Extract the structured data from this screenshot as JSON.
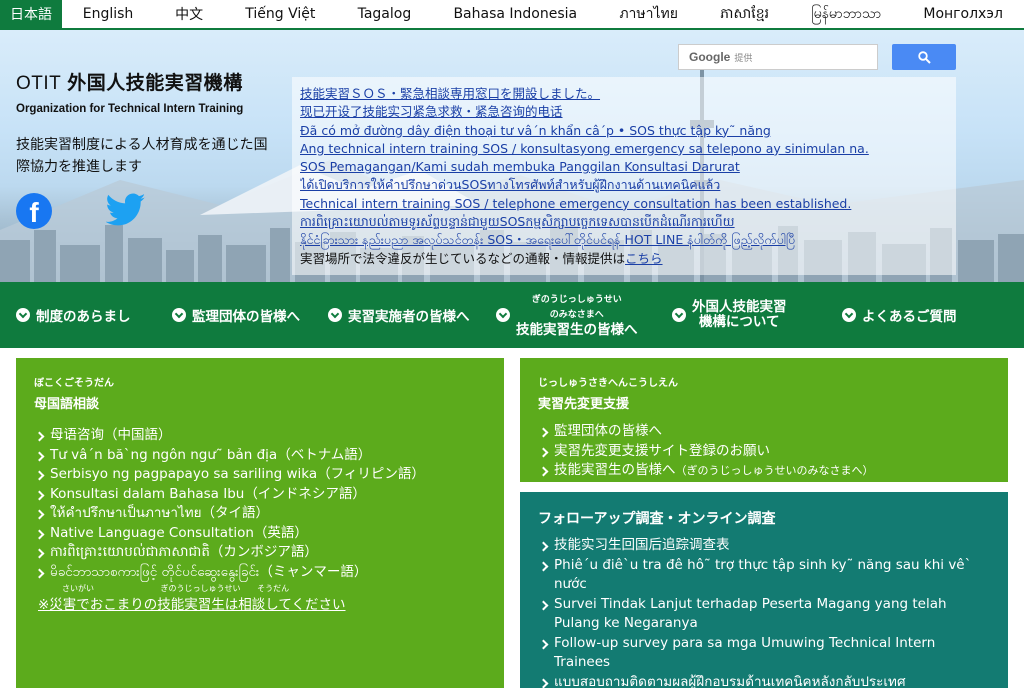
{
  "languages": [
    "日本語",
    "English",
    "中文",
    "Tiếng Việt",
    "Tagalog",
    "Bahasa Indonesia",
    "ภาษาไทย",
    "ភាសាខ្មែរ",
    "မြန်မာဘာသာ",
    "Монголхэл"
  ],
  "brand": {
    "abbr": "OTIT",
    "name_jp": "外国人技能実習機構",
    "name_en": "Organization for Technical Intern Training",
    "tagline": "技能実習制度による人材育成を通じた国際協力を推進します"
  },
  "search": {
    "logo": "Google",
    "provider": "提供"
  },
  "icons": {
    "facebook": "facebook-icon",
    "twitter": "twitter-icon",
    "search": "search-icon",
    "chevron": "chevron-down-icon"
  },
  "notices": [
    "技能実習ＳＯＳ・緊急相談専用窓口を開設しました。",
    "现已开设了技能实习紧急求救・紧急咨询的电话",
    "Đã có mở đường dây điện thoại tư vâ´n khẩn câ´p • SOS thực tập ky˜ năng",
    "Ang technical intern training SOS / konsultasyong emergency sa telepono ay sinimulan na.",
    "SOS Pemagangan/Kami sudah membuka Panggilan Konsultasi Darurat",
    "ได้เปิดบริการให้คำปรึกษาด่วนSOSทางโทรศัพท์สำหรับผู้ฝึกงานด้านเทคนิคแล้ว",
    "Technical intern training SOS / telephone emergency consultation has been established.",
    "ការពិគ្រោះយោបល់តាមទូរស័ព្ទបន្ទាន់ជាមួយSOSកម្មសិក្សាបច្ចេកទេសបានបើកដំណើរការហើយ",
    "နိုင်ငံခြားသား နည်းပညာ အလုပ်သင်တန်း SOS・အရေးပေါ်တိုင်ပင်ရန် HOT LINE နံပါတ်ကို ဖြည့်လိုက်ပါပြီ"
  ],
  "report": {
    "text": "実習場所で法令違反が生じているなどの通報・情報提供は",
    "link": "こちら"
  },
  "nav": [
    {
      "label": "制度のあらまし"
    },
    {
      "label": "監理団体の皆様へ"
    },
    {
      "label": "実習実施者の皆様へ"
    },
    {
      "ruby1": "ぎのうじっしゅうせい",
      "ruby2": "のみなさまへ",
      "label": "技能実習生の皆様へ"
    },
    {
      "line1": "外国人技能実習",
      "line2": "機構について"
    },
    {
      "label": "よくあるご質問"
    }
  ],
  "panel_native": {
    "ruby": "ぼこくごそうだん",
    "title": "母国語相談",
    "items": [
      "母语咨询（中国語）",
      "Tư vâ´n bă`ng ngôn ngư˜ bản địa（ベトナム語）",
      "Serbisyo ng pagpapayo sa sariling wika（フィリピン語）",
      "Konsultasi dalam Bahasa Ibu（インドネシア語）",
      "ให้คำปรึกษาเป็นภาษาไทย（タイ語）",
      "Native Language Consultation（英語）",
      "ការពិគ្រោះយោបល់ជាភាសាជាតិ（カンボジア語）",
      "မိခင်ဘာသာစကားဖြင့် တိုင်ပင်ဆွေးနွေးခြင်း（ミャンマー語）"
    ],
    "ruby_row": [
      "さいがい",
      "ぎのうじっしゅうせい",
      "そうだん"
    ],
    "disaster": "※災害でおこまりの技能実習生は相談してください"
  },
  "panel_change": {
    "ruby": "じっしゅうさきへんこうしえん",
    "title": "実習先変更支援",
    "items": [
      "監理団体の皆様へ",
      "実習先変更支援サイト登録のお願い",
      "技能実習生の皆様へ"
    ],
    "item3_note": "（ぎのうじっしゅうせいのみなさまへ）"
  },
  "panel_followup": {
    "title": "フォローアップ調査・オンライン調査",
    "items": [
      "技能实习生回国后追踪调查表",
      "Phiê´u điê`u tra đê hô˜ trợ thực tập sinh ky˜ năng sau khi vê` nước",
      "Survei Tindak Lanjut terhadap Peserta Magang yang telah Pulang ke Negaranya",
      "Follow-up survey para sa mga Umuwing Technical Intern Trainees",
      "แบบสอบถามติดตามผลผู้ฝึกอบรมด้านเทคนิคหลังกลับประเทศ"
    ]
  },
  "colors": {
    "nav_green": "#0f7b3e",
    "panel_green": "#5cab1c",
    "panel_teal": "#137b72",
    "link_blue": "#1a3fa6"
  }
}
